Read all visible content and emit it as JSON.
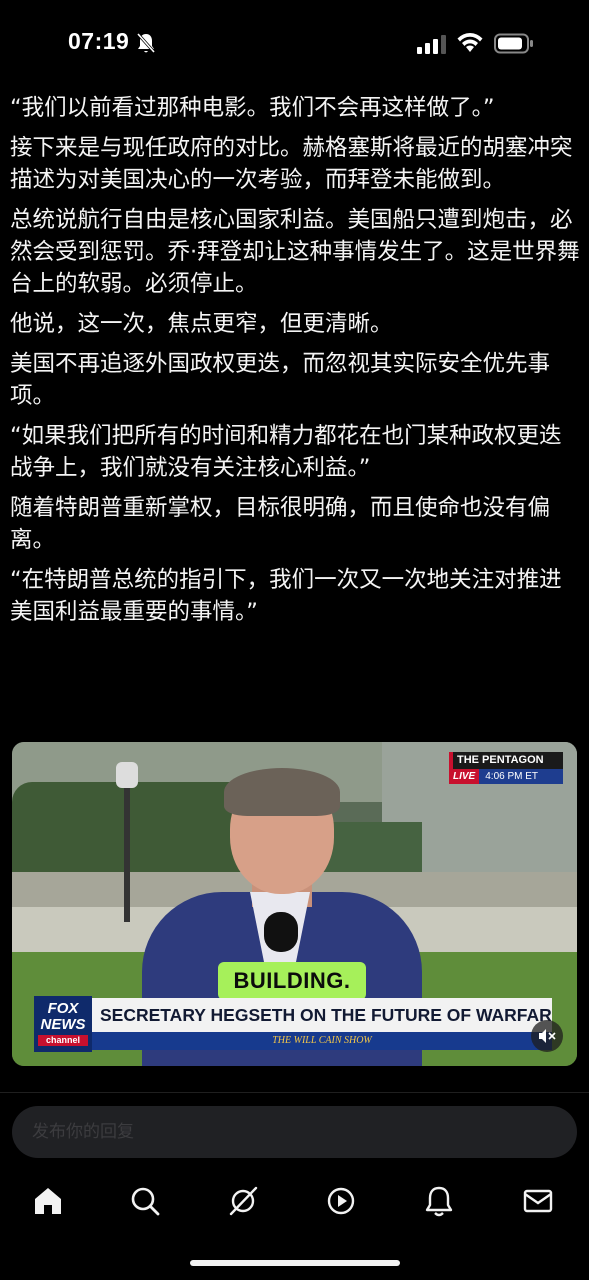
{
  "status_bar": {
    "time": "07:19"
  },
  "article": {
    "paragraphs": [
      "“我们以前看过那种电影。我们不会再这样做了。”",
      "接下来是与现任政府的对比。赫格塞斯将最近的胡塞冲突描述为对美国决心的一次考验，而拜登未能做到。",
      "总统说航行自由是核心国家利益。美国船只遭到炮击，必然会受到惩罚。乔·拜登却让这种事情发生了。这是世界舞台上的软弱。必须停止。",
      "他说，这一次，焦点更窄，但更清晰。",
      "美国不再追逐外国政权更迭，而忽视其实际安全优先事项。",
      "“如果我们把所有的时间和精力都花在也门某种政权更迭战争上，我们就没有关注核心利益。”",
      "随着特朗普重新掌权，目标很明确，而且使命也没有偏离。",
      "“在特朗普总统的指引下，我们一次又一次地关注对推进美国利益最重要的事情。”"
    ]
  },
  "video": {
    "channel_badge": "THE PENTAGON",
    "live_label": "LIVE",
    "live_time": "4:06 PM ET",
    "caption": "BUILDING.",
    "lower_third": "SECRETARY HEGSETH ON THE FUTURE OF WARFARE",
    "logo_line1": "FOX",
    "logo_line2": "NEWS",
    "logo_line3": "channel",
    "show_name": "THE WILL CAIN SHOW",
    "mute_icon": "speaker-muted-icon"
  },
  "reply": {
    "placeholder": "发布你的回复"
  },
  "nav": {
    "items": [
      "home-icon",
      "search-icon",
      "grok-icon",
      "video-icon",
      "notifications-icon",
      "messages-icon"
    ]
  },
  "colors": {
    "background": "#000000",
    "text": "#f4f4f4",
    "fox_red": "#c8102e",
    "fox_blue": "#0f2a6b",
    "caption_green": "#a6f05a"
  }
}
